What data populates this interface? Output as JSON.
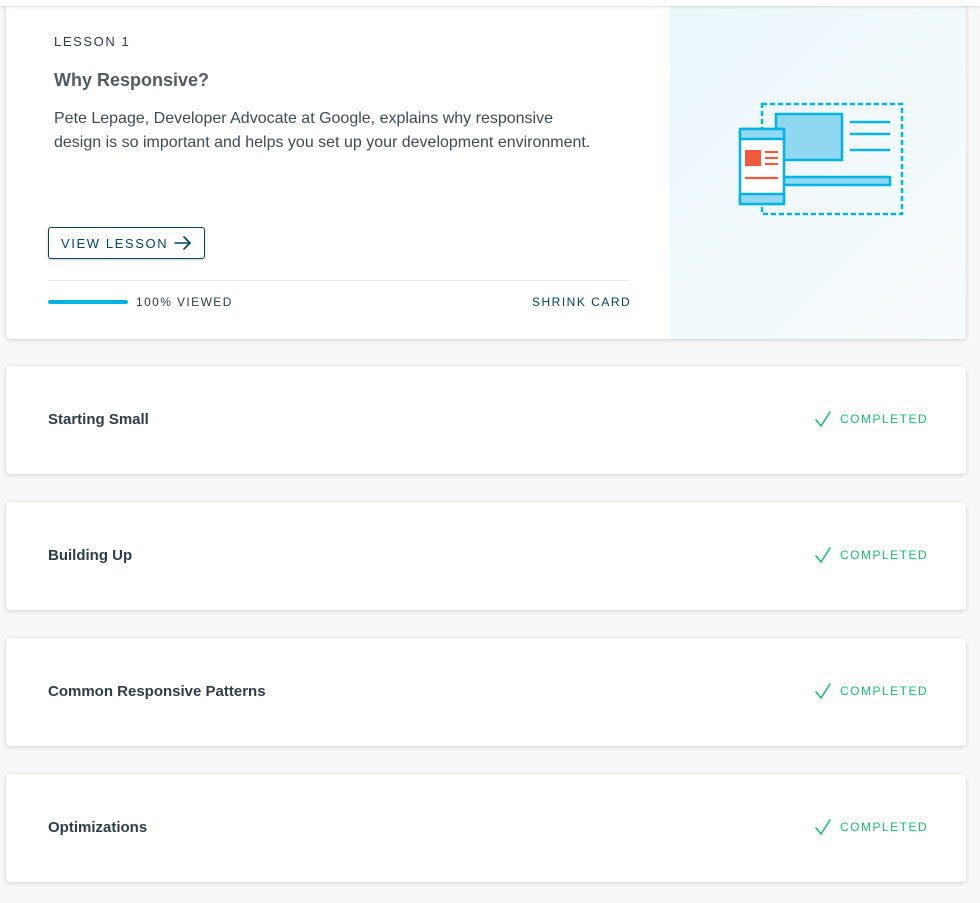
{
  "lesson": {
    "kicker": "LESSON 1",
    "title": "Why Responsive?",
    "description": "Pete Lepage, Developer Advocate at Google, explains why responsive design is so important and helps you set up your development environment.",
    "view_button": "VIEW LESSON",
    "view_button_icon": "arrow-right-icon",
    "progress_text": "100% VIEWED",
    "progress_fraction": 1.0,
    "shrink_label": "SHRINK CARD",
    "illustration_icon": "responsive-devices-illustration"
  },
  "rows": [
    {
      "title": "Starting Small",
      "status": "COMPLETED",
      "status_icon": "check-icon"
    },
    {
      "title": "Building Up",
      "status": "COMPLETED",
      "status_icon": "check-icon"
    },
    {
      "title": "Common Responsive Patterns",
      "status": "COMPLETED",
      "status_icon": "check-icon"
    },
    {
      "title": "Optimizations",
      "status": "COMPLETED",
      "status_icon": "check-icon"
    }
  ],
  "colors": {
    "accent": "#02465e",
    "progress": "#02b3e4",
    "completed": "#15c26b",
    "illustration_blue": "#02b3e4",
    "illustration_fill": "#8fd8f0",
    "illustration_red": "#f15a3b"
  }
}
